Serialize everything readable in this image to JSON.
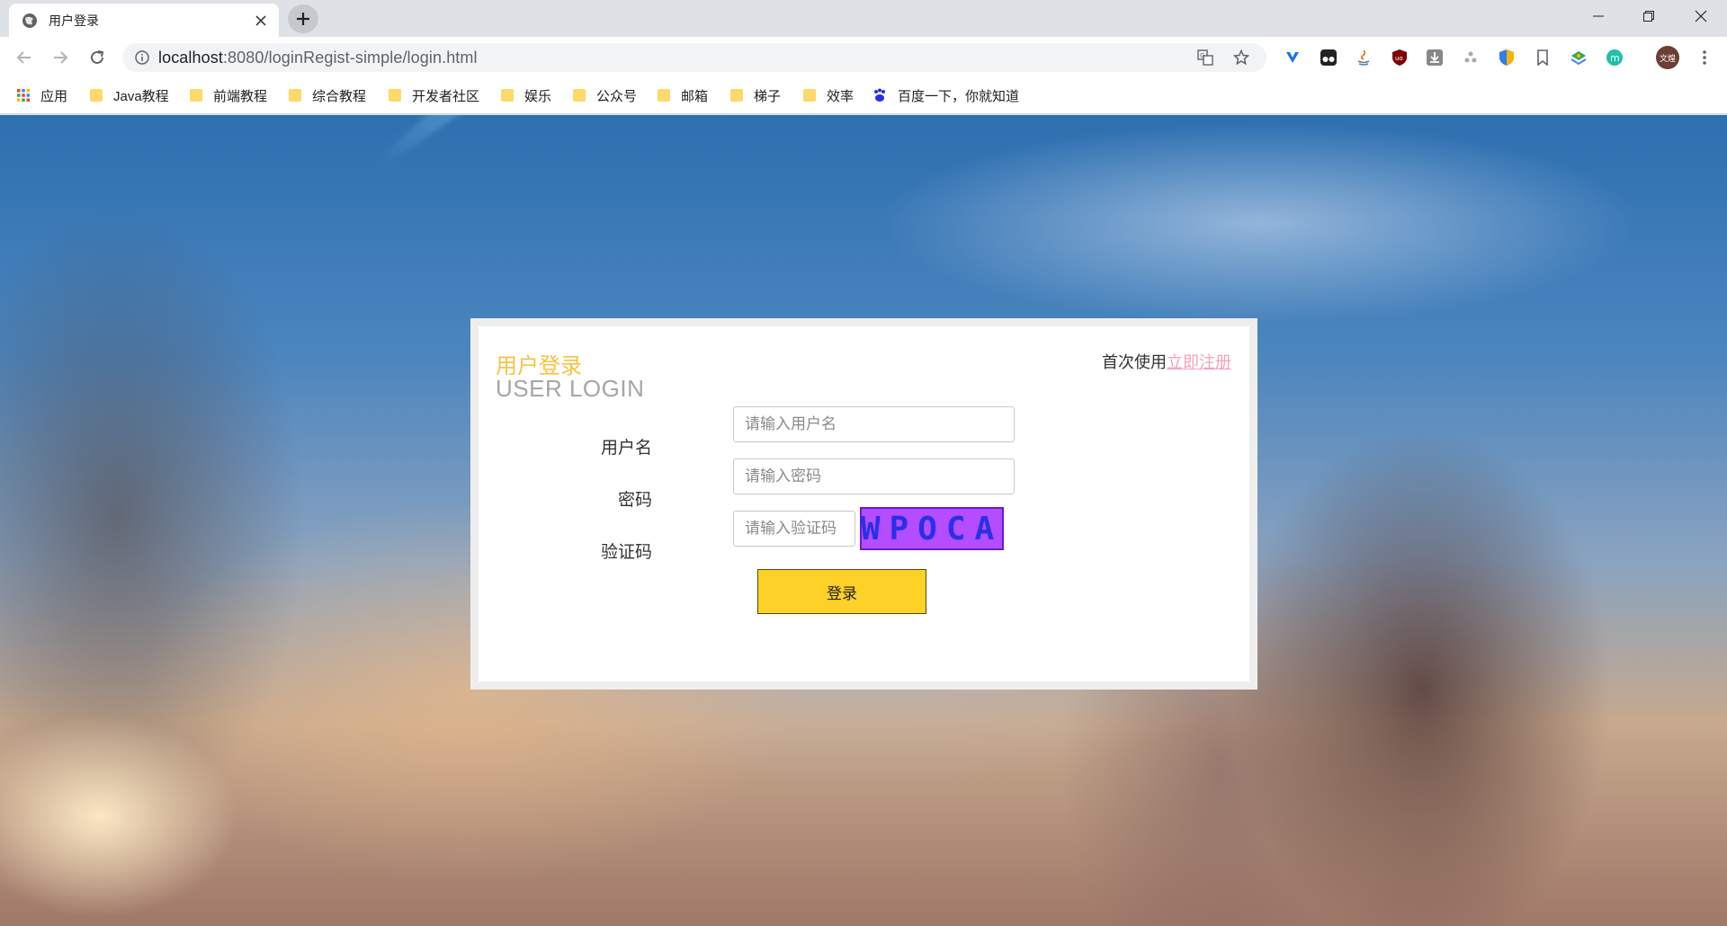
{
  "browser": {
    "tab_title": "用户登录",
    "url_host": "localhost",
    "url_rest": ":8080/loginRegist-simple/login.html",
    "bookmarks": [
      {
        "label": "应用",
        "icon": "apps-grid-icon"
      },
      {
        "label": "Java教程",
        "icon": "folder-icon"
      },
      {
        "label": "前端教程",
        "icon": "folder-icon"
      },
      {
        "label": "综合教程",
        "icon": "folder-icon"
      },
      {
        "label": "开发者社区",
        "icon": "folder-icon"
      },
      {
        "label": "娱乐",
        "icon": "folder-icon"
      },
      {
        "label": "公众号",
        "icon": "folder-icon"
      },
      {
        "label": "邮箱",
        "icon": "folder-icon"
      },
      {
        "label": "梯子",
        "icon": "folder-icon"
      },
      {
        "label": "效率",
        "icon": "folder-icon"
      },
      {
        "label": "百度一下，你就知道",
        "icon": "baidu-paw-icon"
      }
    ],
    "avatar_text": "文煌"
  },
  "login": {
    "title_cn": "用户登录",
    "title_en": "USER LOGIN",
    "register_prompt": "首次使用",
    "register_link": "立即注册",
    "username_label": "用户名",
    "username_placeholder": "请输入用户名",
    "password_label": "密码",
    "password_placeholder": "请输入密码",
    "captcha_label": "验证码",
    "captcha_placeholder": "请输入验证码",
    "captcha_text": "WPOCA",
    "submit_label": "登录"
  },
  "colors": {
    "accent_yellow": "#fdd127",
    "title_yellow": "#f6c343",
    "link_pink": "#f5a3b8",
    "captcha_bg": "#b44dff"
  }
}
